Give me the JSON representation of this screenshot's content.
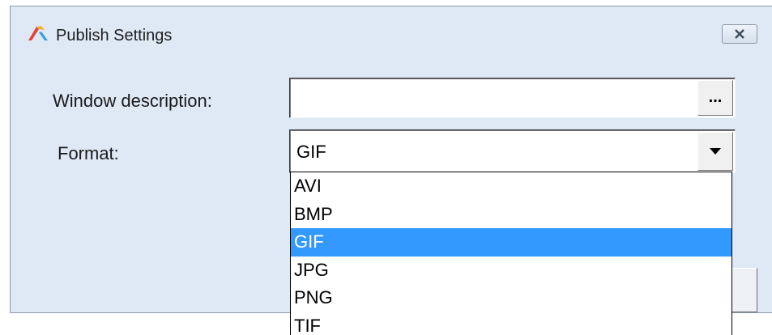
{
  "window": {
    "title": "Publish Settings",
    "icon": "app-logo-icon",
    "close_icon": "close-icon"
  },
  "form": {
    "description_label": "Window description:",
    "description_value": "",
    "browse_label": "...",
    "format_label": "Format:",
    "format_selected": "GIF"
  },
  "dropdown": {
    "options": [
      "AVI",
      "BMP",
      "GIF",
      "JPG",
      "PNG",
      "TIF"
    ],
    "selected_index": 2,
    "selection_color": "#3399ff"
  }
}
